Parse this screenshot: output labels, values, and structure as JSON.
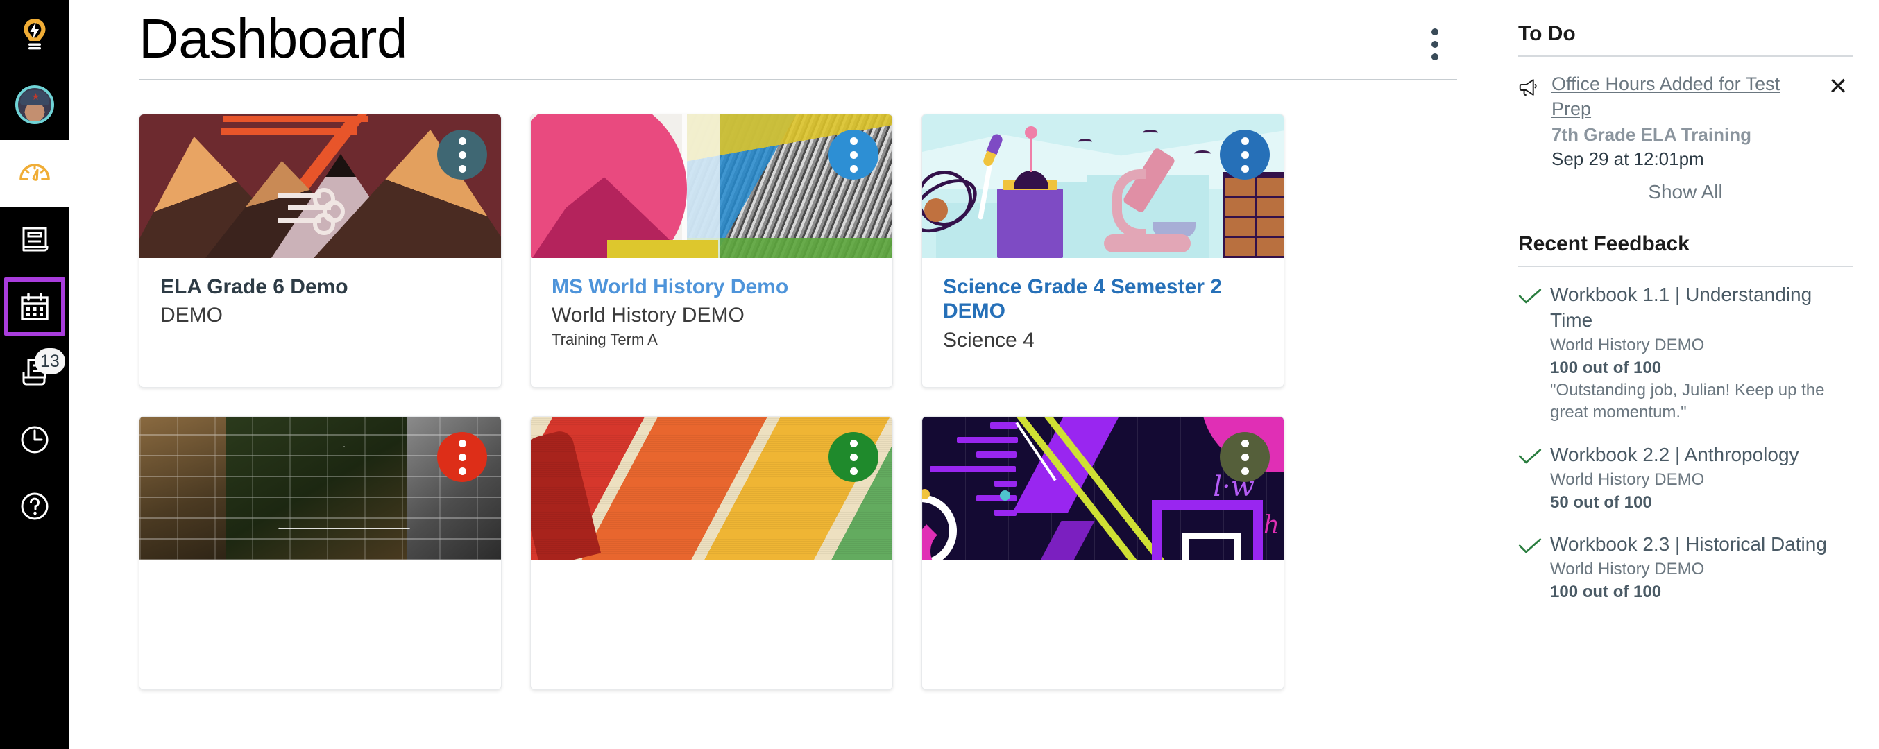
{
  "global_nav": {
    "logo_icon": "lightbulb-logo-icon",
    "avatar": "user-avatar",
    "items": [
      {
        "icon": "dashboard-gauge-icon",
        "label": "Dashboard",
        "active": true
      },
      {
        "icon": "courses-book-icon",
        "label": "Courses",
        "active": false
      },
      {
        "icon": "calendar-icon",
        "label": "Calendar",
        "active": false,
        "focused": true
      },
      {
        "icon": "inbox-icon",
        "label": "Inbox",
        "badge": "13",
        "active": false
      },
      {
        "icon": "history-clock-icon",
        "label": "History",
        "active": false
      },
      {
        "icon": "help-question-icon",
        "label": "Help",
        "active": false
      }
    ]
  },
  "header": {
    "title": "Dashboard",
    "options_button": "dashboard-options-kebab"
  },
  "cards": [
    {
      "title": "ELA Grade 6 Demo",
      "title_color": "#2d3b45",
      "subtitle": "DEMO",
      "term": "",
      "kebab_color": "#3f6773",
      "art": "mountains"
    },
    {
      "title": "MS World History Demo",
      "title_color": "#4e94da",
      "subtitle": "World History DEMO",
      "term": "Training Term A",
      "kebab_color": "#2d8fd4",
      "art": "collage"
    },
    {
      "title": "Science Grade 4 Semester 2 DEMO",
      "title_color": "#2670b8",
      "subtitle": "Science 4",
      "term": "",
      "kebab_color": "#2670b8",
      "art": "science"
    },
    {
      "title": "",
      "title_color": "#2d3b45",
      "subtitle": "",
      "term": "",
      "kebab_color": "#dd2e18",
      "art": "history"
    },
    {
      "title": "",
      "title_color": "#2d3b45",
      "subtitle": "",
      "term": "",
      "kebab_color": "#1f8a2c",
      "art": "stripes"
    },
    {
      "title": "",
      "title_color": "#2d3b45",
      "subtitle": "",
      "term": "",
      "kebab_color": "#555f3a",
      "art": "math"
    }
  ],
  "todo": {
    "heading": "To Do",
    "items": [
      {
        "icon": "announcement-megaphone-icon",
        "link": "Office Hours Added for Test Prep",
        "course": "7th Grade ELA Training",
        "date": "Sep 29 at 12:01pm",
        "close": "✕"
      }
    ],
    "show_all": "Show All"
  },
  "recent_feedback": {
    "heading": "Recent Feedback",
    "items": [
      {
        "icon": "check-icon",
        "title": "Workbook 1.1 | Understanding Time",
        "course": "World History DEMO",
        "score": "100 out of 100",
        "comment": "\"Outstanding job, Julian! Keep up the great momentum.\""
      },
      {
        "icon": "check-icon",
        "title": "Workbook 2.2 | Anthropology",
        "course": "World History DEMO",
        "score": "50 out of 100",
        "comment": ""
      },
      {
        "icon": "check-icon",
        "title": "Workbook 2.3 | Historical Dating",
        "course": "World History DEMO",
        "score": "100 out of 100",
        "comment": ""
      }
    ]
  },
  "colors": {
    "nav_background": "#000000",
    "focus_ring": "#a93ddd",
    "accent_yellow": "#f0ad36",
    "check_green": "#2a7d3f"
  }
}
